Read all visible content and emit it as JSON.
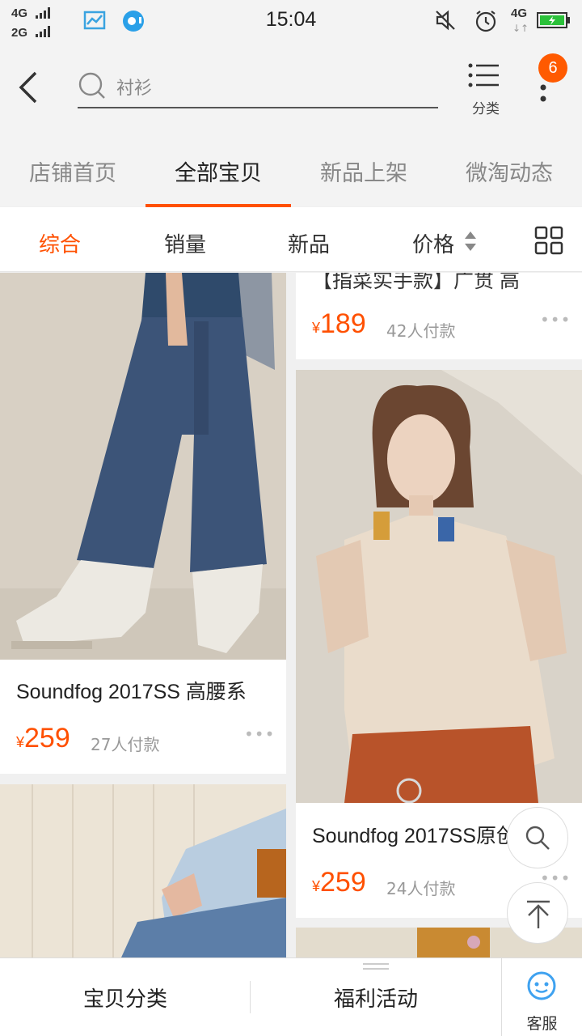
{
  "status_bar": {
    "net1": "4G",
    "net2": "2G",
    "time": "15:04",
    "net_right": "4G"
  },
  "search": {
    "placeholder": "衬衫",
    "category_label": "分类",
    "badge_count": "6"
  },
  "tabs": [
    {
      "label": "店铺首页"
    },
    {
      "label": "全部宝贝"
    },
    {
      "label": "新品上架"
    },
    {
      "label": "微淘动态"
    }
  ],
  "sort": {
    "items": [
      {
        "label": "综合"
      },
      {
        "label": "销量"
      },
      {
        "label": "新品"
      },
      {
        "label": "价格"
      }
    ],
    "active": "综合"
  },
  "products": {
    "left": [
      {
        "title": "Soundfog 2017SS 高腰系",
        "currency": "¥",
        "price": "259",
        "sold": "27人付款"
      }
    ],
    "right": [
      {
        "title": "【指菜实手款】广贯 高",
        "currency": "¥",
        "price": "189",
        "sold": "42人付款"
      },
      {
        "title": "Soundfog 2017SS原创设",
        "currency": "¥",
        "price": "259",
        "sold": "24人付款"
      }
    ]
  },
  "more_glyph": "•••",
  "bottom_bar": {
    "category": "宝贝分类",
    "activity": "福利活动",
    "service": "客服"
  },
  "colors": {
    "accent": "#ff5000",
    "badge": "#ff5a00",
    "service": "#3fa2f0"
  }
}
